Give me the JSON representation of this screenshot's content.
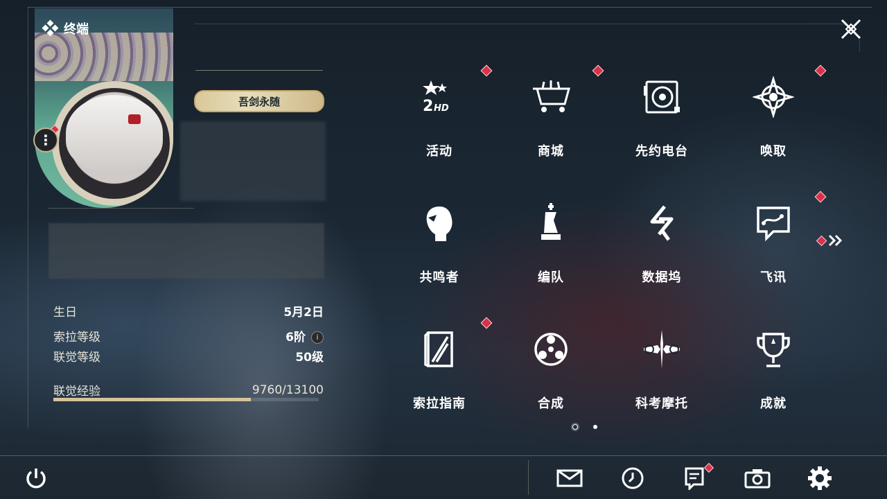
{
  "header": {
    "title": "终端",
    "title_icon": "four-diamonds-icon",
    "close_icon": "close-x-icon"
  },
  "profile": {
    "title_badge": "吾剑永随",
    "more_icon": "more-dots-icon",
    "info": [
      {
        "label": "生日",
        "value": "5月2日"
      },
      {
        "label": "索拉等级",
        "value": "6阶"
      },
      {
        "label": "联觉等级",
        "value": "50级"
      }
    ],
    "xp": {
      "label": "联觉经验",
      "value": "9760/13100",
      "progress": 0.745
    }
  },
  "menu": [
    {
      "label": "活动",
      "icon": "event-2hd-icon",
      "badge": true
    },
    {
      "label": "商城",
      "icon": "shop-cart-icon",
      "badge": true
    },
    {
      "label": "先约电台",
      "icon": "radio-icon",
      "badge": false
    },
    {
      "label": "唤取",
      "icon": "summon-compass-icon",
      "badge": true
    },
    {
      "label": "共鸣者",
      "icon": "resonator-head-icon",
      "badge": false
    },
    {
      "label": "编队",
      "icon": "chess-team-icon",
      "badge": false
    },
    {
      "label": "数据坞",
      "icon": "data-dock-icon",
      "badge": false
    },
    {
      "label": "飞讯",
      "icon": "chat-bubble-icon",
      "badge": true
    },
    {
      "label": "索拉指南",
      "icon": "guide-book-icon",
      "badge": true
    },
    {
      "label": "合成",
      "icon": "synthesis-icon",
      "badge": false
    },
    {
      "label": "科考摩托",
      "icon": "motorbike-icon",
      "badge": false
    },
    {
      "label": "成就",
      "icon": "trophy-icon",
      "badge": false
    }
  ],
  "pager": {
    "next_icon": "double-chevron-right-icon",
    "pages": 2,
    "current": 1
  },
  "bottom": {
    "power_icon": "power-icon",
    "icons": [
      "mail-icon",
      "clock-icon",
      "notice-icon",
      "camera-icon",
      "settings-gear-icon"
    ]
  },
  "colors": {
    "accent": "#d7c39b",
    "badge_red": "#d6334a",
    "background": "#1b2834"
  }
}
